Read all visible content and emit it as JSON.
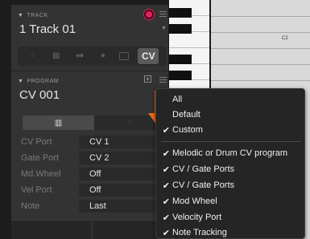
{
  "track": {
    "section_label": "TRACK",
    "name": "1 Track 01"
  },
  "track_types": [
    "drum-icon",
    "keyboard-icon",
    "plug-icon",
    "sample-icon",
    "audio-icon",
    "CV"
  ],
  "program": {
    "section_label": "PROGRAM",
    "name": "CV 001"
  },
  "properties": [
    {
      "label": "CV Port",
      "value": "CV 1"
    },
    {
      "label": "Gate Port",
      "value": "CV 2"
    },
    {
      "label": "Md.Wheel",
      "value": "Off"
    },
    {
      "label": "Vel Port",
      "value": "Off"
    },
    {
      "label": "Note",
      "value": "Last"
    }
  ],
  "piano": {
    "c2_label": "C2"
  },
  "menu": {
    "items": [
      {
        "label": "All",
        "checked": false
      },
      {
        "label": "Default",
        "checked": false
      },
      {
        "label": "Custom",
        "checked": true
      },
      {
        "label": "Melodic or Drum CV program",
        "checked": true
      },
      {
        "label": "CV / Gate Ports",
        "checked": true
      },
      {
        "label": "CV / Gate Ports",
        "checked": true
      },
      {
        "label": "Mod Wheel",
        "checked": true
      },
      {
        "label": "Velocity Port",
        "checked": true
      },
      {
        "label": "Note Tracking",
        "checked": true
      }
    ]
  },
  "colors": {
    "record": "#e0245e",
    "arrow": "#f26b1d"
  }
}
